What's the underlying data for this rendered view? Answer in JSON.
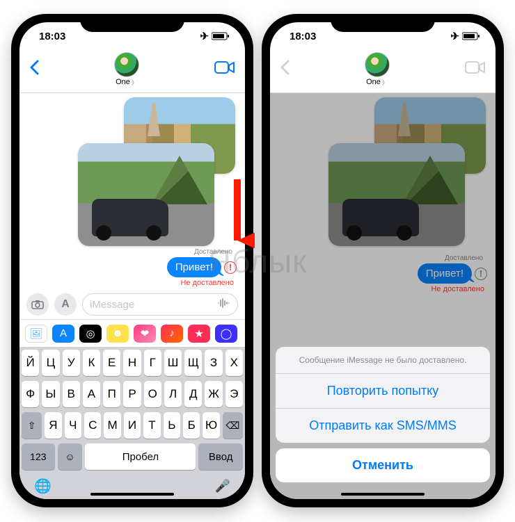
{
  "status": {
    "time": "18:03"
  },
  "contact": {
    "name": "One"
  },
  "message": {
    "delivered_label": "Доставлено",
    "bubble_text": "Привет!",
    "not_delivered_label": "Не доставлено"
  },
  "compose": {
    "placeholder": "iMessage"
  },
  "apps": {
    "row": [
      {
        "bg": "#fff",
        "glyph": "🖼"
      },
      {
        "bg": "#0a84ff",
        "glyph": "A"
      },
      {
        "bg": "#000",
        "glyph": "◎"
      },
      {
        "bg": "#ffe14d",
        "glyph": "☻"
      },
      {
        "bg": "linear-gradient(135deg,#ff3b7f,#ff8ab8)",
        "glyph": "❤"
      },
      {
        "bg": "linear-gradient(135deg,#ff2d55,#ff6a00)",
        "glyph": "♪"
      },
      {
        "bg": "#ff2d55",
        "glyph": "★"
      },
      {
        "bg": "#3b30ff",
        "glyph": "◯"
      }
    ]
  },
  "keyboard": {
    "row1": [
      "Й",
      "Ц",
      "У",
      "К",
      "Е",
      "Н",
      "Г",
      "Ш",
      "Щ",
      "З",
      "Х"
    ],
    "row2": [
      "Ф",
      "Ы",
      "В",
      "А",
      "П",
      "Р",
      "О",
      "Л",
      "Д",
      "Ж",
      "Э"
    ],
    "row3_shift": "⇧",
    "row3": [
      "Я",
      "Ч",
      "С",
      "М",
      "И",
      "Т",
      "Ь",
      "Б",
      "Ю"
    ],
    "row3_del": "⌫",
    "row4": {
      "num": "123",
      "emoji": "☺",
      "space": "Пробел",
      "enter": "Ввод"
    },
    "globe": "🌐",
    "mic": "🎤"
  },
  "sheet": {
    "message": "Сообщение iMessage не было доставлено.",
    "retry": "Повторить попытку",
    "send_sms": "Отправить как SMS/MMS",
    "cancel": "Отменить"
  },
  "watermark": "Яблык"
}
